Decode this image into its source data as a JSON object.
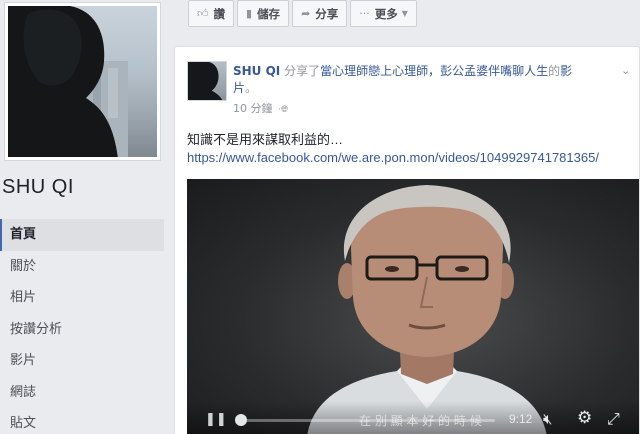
{
  "page": {
    "name": "SHU QI",
    "nav": [
      {
        "label": "首頁",
        "active": true
      },
      {
        "label": "關於",
        "active": false
      },
      {
        "label": "相片",
        "active": false
      },
      {
        "label": "按讚分析",
        "active": false
      },
      {
        "label": "影片",
        "active": false
      },
      {
        "label": "網誌",
        "active": false
      },
      {
        "label": "貼文",
        "active": false
      }
    ]
  },
  "toolbar": {
    "like": {
      "label": "讚",
      "icon": "thumbs-up-icon"
    },
    "save": {
      "label": "儲存",
      "icon": "bookmark-icon"
    },
    "share": {
      "label": "分享",
      "icon": "share-arrow-icon"
    },
    "more": {
      "label": "更多",
      "icon": "ellipsis-icon"
    }
  },
  "post": {
    "author": "SHU QI",
    "action_text": " 分享了",
    "shared_page": "當心理師戀上心理師，彭公孟婆伴嘴聊人生",
    "possessive": "的",
    "object": "影片",
    "period": "。",
    "time": "10 分鐘",
    "body_text": "知識不是用來謀取利益的…",
    "url": "https://www.facebook.com/we.are.pon.mon/videos/1049929741781365/",
    "video": {
      "duration": "9:12",
      "subtitle": "在 別 顯 本 好 的 時 候"
    }
  },
  "colors": {
    "fb_link": "#365899",
    "active_nav_border": "#4267b2",
    "page_bg": "#e9ebee"
  }
}
